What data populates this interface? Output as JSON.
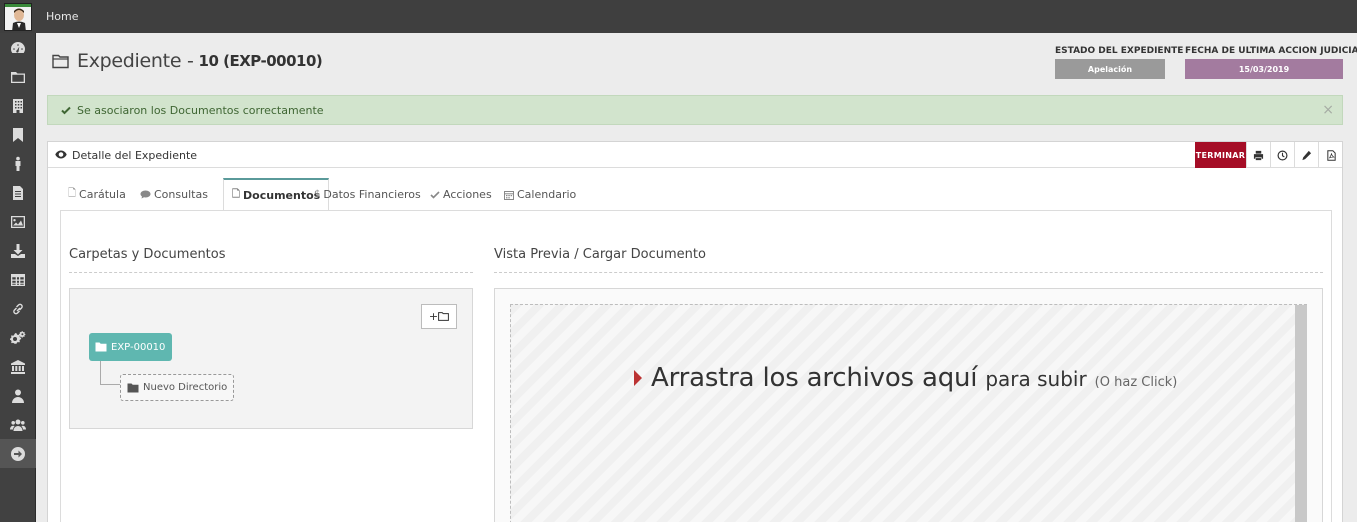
{
  "topbar": {
    "home_label": "Home"
  },
  "sidebar": {
    "items": [
      {
        "icon": "dashboard-icon"
      },
      {
        "icon": "folder-icon"
      },
      {
        "icon": "building-icon"
      },
      {
        "icon": "bookmark-icon"
      },
      {
        "icon": "person-icon"
      },
      {
        "icon": "document-icon"
      },
      {
        "icon": "image-icon"
      },
      {
        "icon": "download-icon"
      },
      {
        "icon": "table-icon"
      },
      {
        "icon": "link-icon"
      },
      {
        "icon": "gears-icon"
      },
      {
        "icon": "bank-icon"
      },
      {
        "icon": "user-icon"
      },
      {
        "icon": "users-icon"
      },
      {
        "icon": "arrow-right-circle-icon"
      }
    ]
  },
  "header": {
    "title": "Expediente -",
    "code": "10 (EXP-00010)",
    "estado_label": "ESTADO DEL EXPEDIENTE",
    "estado_value": "Apelación",
    "fecha_label": "FECHA DE ULTIMA ACCION JUDICIAL",
    "fecha_value": "15/03/2019"
  },
  "alert": {
    "message": "Se asociaron los Documentos correctamente",
    "close": "×"
  },
  "panel": {
    "title": "Detalle del Expediente",
    "terminar_label": "TERMINAR",
    "actions": [
      "print-icon",
      "clock-icon",
      "pencil-icon",
      "pdf-icon"
    ]
  },
  "tabs": [
    {
      "label": "Carátula",
      "icon": "file-icon"
    },
    {
      "label": "Consultas",
      "icon": "comment-icon"
    },
    {
      "label": "Documentos",
      "icon": "file-icon",
      "active": true
    },
    {
      "label": "Datos Financieros",
      "icon": "dollar-icon"
    },
    {
      "label": "Acciones",
      "icon": "check-icon"
    },
    {
      "label": "Calendario",
      "icon": "calendar-icon"
    }
  ],
  "documentos": {
    "left_title": "Carpetas y Documentos",
    "right_title": "Vista Previa / Cargar Documento",
    "add_folder_label": "+",
    "tree_root": "EXP-00010",
    "tree_child": "Nuevo Directorio",
    "drop_big": "Arrastra los archivos aquí",
    "drop_mid": "para subir",
    "drop_small": "(O haz Click)"
  },
  "colors": {
    "topbar": "#3f3f3f",
    "sidebar": "#414141",
    "estado_badge": "#9a9a9a",
    "fecha_badge": "#a37b9f",
    "alert_bg": "#d2e4cd",
    "terminar": "#a50d26",
    "tree_root": "#5fb7b0"
  }
}
